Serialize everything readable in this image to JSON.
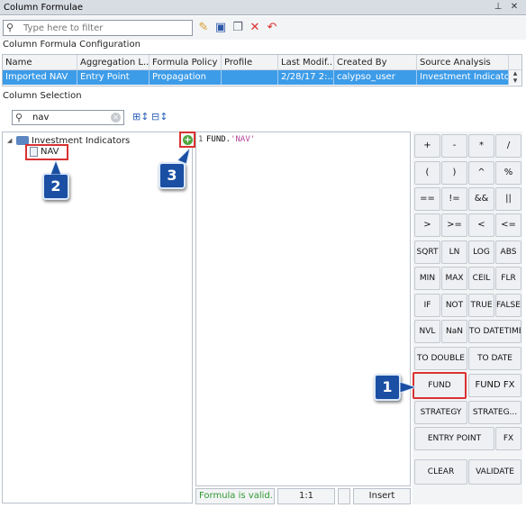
{
  "window": {
    "title": "Column Formulae"
  },
  "toolbar": {
    "filter_placeholder": "Type here to filter"
  },
  "config": {
    "section_label": "Column Formula Configuration",
    "columns": [
      "Name",
      "Aggregation L...",
      "Formula Policy",
      "Profile",
      "Last Modif...",
      "Created By",
      "Source Analysis"
    ],
    "row": [
      "Imported NAV",
      "Entry Point",
      "Propagation",
      "",
      "2/28/17 2:...",
      "calypso_user",
      "Investment Indicators"
    ]
  },
  "selection": {
    "section_label": "Column Selection",
    "search_value": "nav",
    "tree_root": "Investment Indicators",
    "tree_child": "NAV"
  },
  "editor": {
    "line_number": "1",
    "code_prefix": "FUND.",
    "code_string": "'NAV'"
  },
  "status": {
    "message": "Formula is valid.",
    "position": "1:1",
    "mode": "Insert"
  },
  "keys": {
    "r1": [
      "+",
      "-",
      "*",
      "/"
    ],
    "r2": [
      "(",
      ")",
      "^",
      "%"
    ],
    "r3": [
      "==",
      "!=",
      "&&",
      "||"
    ],
    "r4": [
      ">",
      ">=",
      "<",
      "<="
    ],
    "r5": [
      "SQRT",
      "LN",
      "LOG",
      "ABS"
    ],
    "r6": [
      "MIN",
      "MAX",
      "CEIL",
      "FLR"
    ],
    "r7": [
      "IF",
      "NOT",
      "TRUE",
      "FALSE"
    ],
    "r8": [
      "NVL",
      "NaN",
      "TO DATETIME"
    ],
    "r9": [
      "TO DOUBLE",
      "TO DATE"
    ],
    "r10": [
      "FUND",
      "FUND FX"
    ],
    "r11": [
      "STRATEGY",
      "STRATEG..."
    ],
    "r12": [
      "ENTRY POINT",
      "FX"
    ],
    "r13": [
      "CLEAR",
      "VALIDATE"
    ]
  },
  "callouts": [
    "1",
    "2",
    "3"
  ],
  "colors": {
    "selection_blue": "#3d9ce8",
    "highlight_red": "#d93131",
    "badge_blue": "#1a4fa3",
    "valid_green": "#2e9a2e"
  }
}
